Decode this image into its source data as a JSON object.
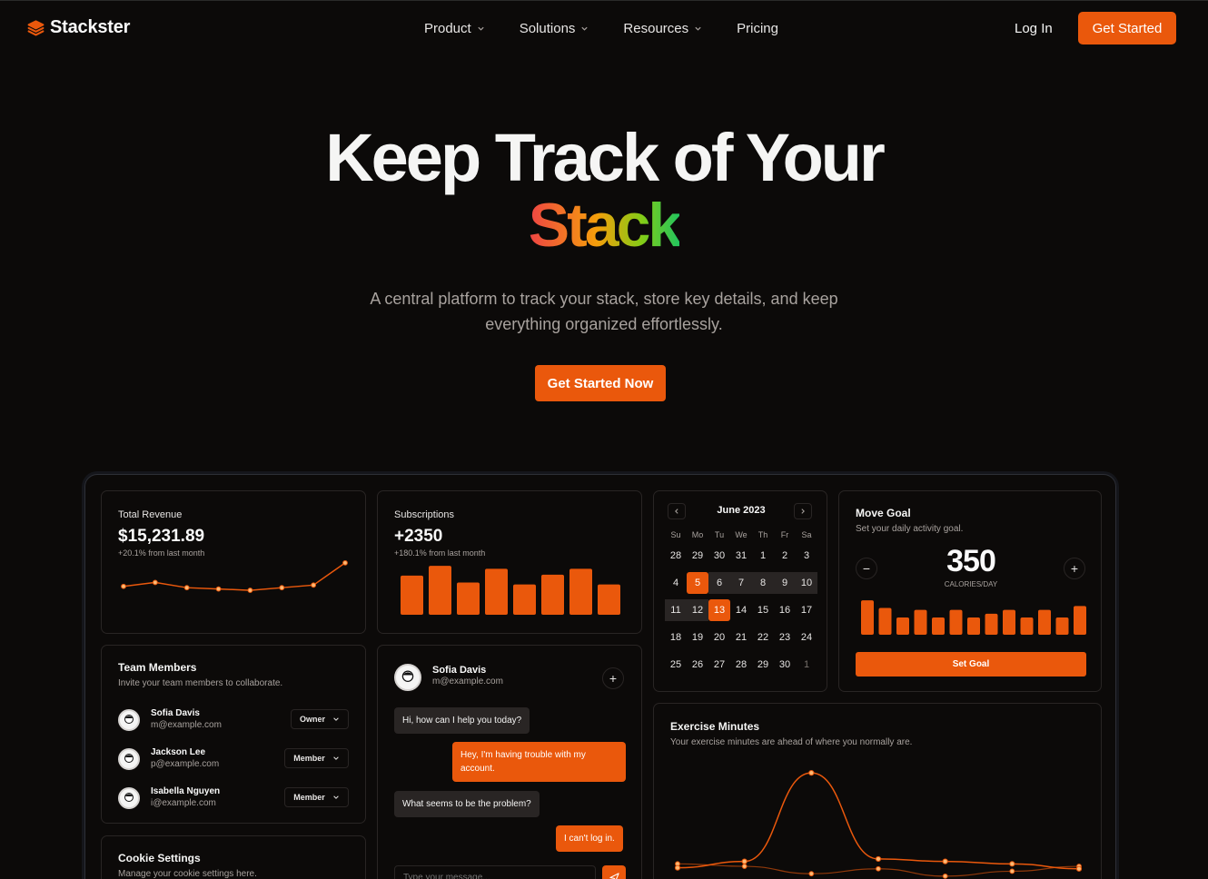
{
  "nav": {
    "brand": "Stackster",
    "links": [
      "Product",
      "Solutions",
      "Resources",
      "Pricing"
    ],
    "login": "Log In",
    "cta": "Get Started"
  },
  "hero": {
    "title_line1": "Keep Track of Your",
    "title_line2": "Stack",
    "subtitle": "A central platform to track your stack, store key details, and keep everything organized effortlessly.",
    "cta": "Get Started Now"
  },
  "revenue": {
    "label": "Total Revenue",
    "value": "$15,231.89",
    "change": "+20.1% from last month",
    "series": [
      12,
      15,
      11,
      10,
      9,
      11,
      13,
      30
    ]
  },
  "subscriptions": {
    "label": "Subscriptions",
    "value": "+2350",
    "change": "+180.1% from last month",
    "bars": [
      40,
      50,
      33,
      47,
      31,
      41,
      47,
      31
    ]
  },
  "calendar": {
    "month": "June 2023",
    "weekdays": [
      "Su",
      "Mo",
      "Tu",
      "We",
      "Th",
      "Fr",
      "Sa"
    ],
    "weeks": [
      [
        "28",
        "29",
        "30",
        "31",
        "1",
        "2",
        "3"
      ],
      [
        "4",
        "5",
        "6",
        "7",
        "8",
        "9",
        "10"
      ],
      [
        "11",
        "12",
        "13",
        "14",
        "15",
        "16",
        "17"
      ],
      [
        "18",
        "19",
        "20",
        "21",
        "22",
        "23",
        "24"
      ],
      [
        "25",
        "26",
        "27",
        "28",
        "29",
        "30",
        "1"
      ]
    ],
    "selected": [
      "5",
      "13"
    ]
  },
  "move_goal": {
    "title": "Move Goal",
    "subtitle": "Set your daily activity goal.",
    "value": "350",
    "unit": "CALORIES/DAY",
    "button": "Set Goal",
    "bars": [
      36,
      28,
      18,
      26,
      18,
      26,
      18,
      22,
      26,
      18,
      26,
      18,
      30
    ]
  },
  "team": {
    "title": "Team Members",
    "subtitle": "Invite your team members to collaborate.",
    "members": [
      {
        "name": "Sofia Davis",
        "email": "m@example.com",
        "role": "Owner"
      },
      {
        "name": "Jackson Lee",
        "email": "p@example.com",
        "role": "Member"
      },
      {
        "name": "Isabella Nguyen",
        "email": "i@example.com",
        "role": "Member"
      }
    ]
  },
  "chat": {
    "name": "Sofia Davis",
    "email": "m@example.com",
    "messages": [
      {
        "from": "in",
        "text": "Hi, how can I help you today?"
      },
      {
        "from": "out",
        "text": "Hey, I'm having trouble with my account."
      },
      {
        "from": "in",
        "text": "What seems to be the problem?"
      },
      {
        "from": "out",
        "text": "I can't log in."
      }
    ],
    "placeholder": "Type your message..."
  },
  "exercise": {
    "title": "Exercise Minutes",
    "subtitle": "Your exercise minutes are ahead of where you normally are.",
    "series_a": [
      32,
      45,
      225,
      50,
      45,
      40,
      30
    ],
    "series_b": [
      40,
      35,
      20,
      30,
      15,
      25,
      35
    ]
  },
  "cookie": {
    "title": "Cookie Settings",
    "subtitle": "Manage your cookie settings here."
  },
  "colors": {
    "accent": "#ea580c",
    "bg": "#0c0a09",
    "border": "#292524"
  }
}
